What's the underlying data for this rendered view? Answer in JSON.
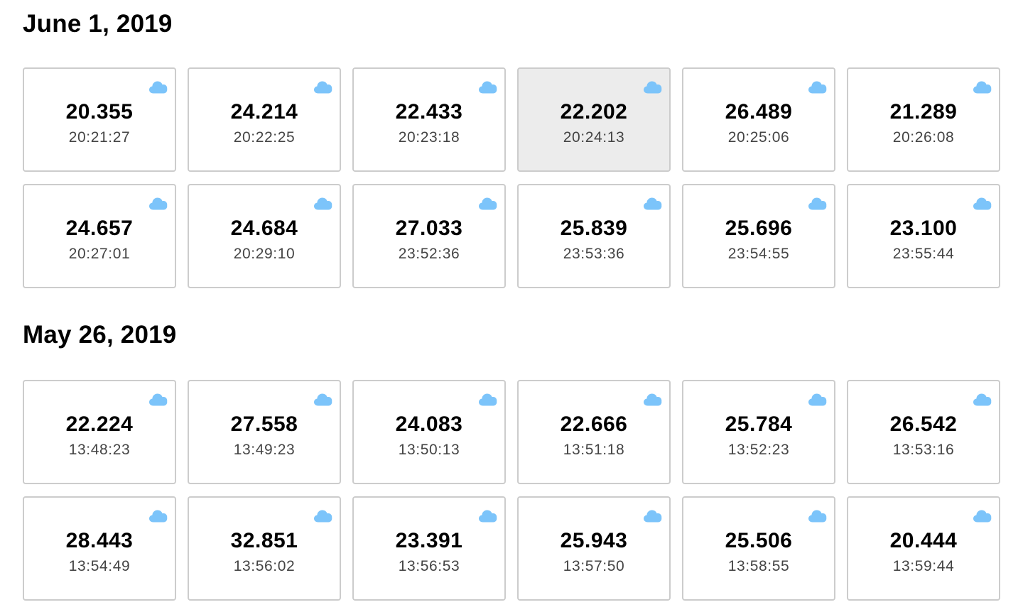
{
  "colors": {
    "cloud_icon": "#7cc4fa",
    "card_border": "#cccccc",
    "card_selected_bg": "#ececec",
    "time_text": "#444444"
  },
  "icon": "cloud-icon",
  "sections": [
    {
      "title": "June 1, 2019",
      "cards": [
        {
          "value": "20.355",
          "time": "20:21:27",
          "selected": false
        },
        {
          "value": "24.214",
          "time": "20:22:25",
          "selected": false
        },
        {
          "value": "22.433",
          "time": "20:23:18",
          "selected": false
        },
        {
          "value": "22.202",
          "time": "20:24:13",
          "selected": true
        },
        {
          "value": "26.489",
          "time": "20:25:06",
          "selected": false
        },
        {
          "value": "21.289",
          "time": "20:26:08",
          "selected": false
        },
        {
          "value": "24.657",
          "time": "20:27:01",
          "selected": false
        },
        {
          "value": "24.684",
          "time": "20:29:10",
          "selected": false
        },
        {
          "value": "27.033",
          "time": "23:52:36",
          "selected": false
        },
        {
          "value": "25.839",
          "time": "23:53:36",
          "selected": false
        },
        {
          "value": "25.696",
          "time": "23:54:55",
          "selected": false
        },
        {
          "value": "23.100",
          "time": "23:55:44",
          "selected": false
        }
      ]
    },
    {
      "title": "May 26, 2019",
      "cards": [
        {
          "value": "22.224",
          "time": "13:48:23",
          "selected": false
        },
        {
          "value": "27.558",
          "time": "13:49:23",
          "selected": false
        },
        {
          "value": "24.083",
          "time": "13:50:13",
          "selected": false
        },
        {
          "value": "22.666",
          "time": "13:51:18",
          "selected": false
        },
        {
          "value": "25.784",
          "time": "13:52:23",
          "selected": false
        },
        {
          "value": "26.542",
          "time": "13:53:16",
          "selected": false
        },
        {
          "value": "28.443",
          "time": "13:54:49",
          "selected": false
        },
        {
          "value": "32.851",
          "time": "13:56:02",
          "selected": false
        },
        {
          "value": "23.391",
          "time": "13:56:53",
          "selected": false
        },
        {
          "value": "25.943",
          "time": "13:57:50",
          "selected": false
        },
        {
          "value": "25.506",
          "time": "13:58:55",
          "selected": false
        },
        {
          "value": "20.444",
          "time": "13:59:44",
          "selected": false
        }
      ]
    }
  ]
}
